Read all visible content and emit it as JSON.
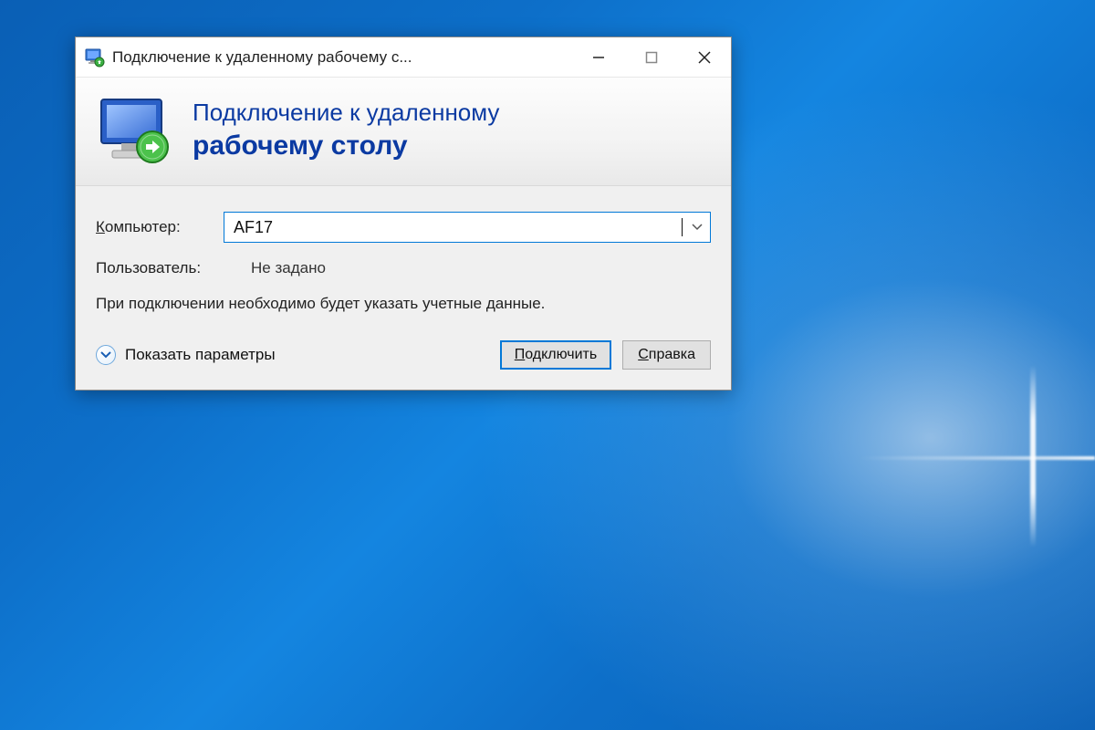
{
  "window": {
    "title": "Подключение к удаленному рабочему с..."
  },
  "banner": {
    "line1": "Подключение к удаленному",
    "line2": "рабочему столу"
  },
  "form": {
    "computer_label_pre": "К",
    "computer_label_rest": "омпьютер:",
    "computer_value": "AF17",
    "user_label": "Пользователь:",
    "user_value": "Не задано",
    "info": "При подключении необходимо будет указать учетные данные."
  },
  "footer": {
    "show_options_pre": "П",
    "show_options_rest": "оказать параметры",
    "connect_pre": "П",
    "connect_rest": "одключить",
    "help_pre": "С",
    "help_rest": "правка"
  }
}
